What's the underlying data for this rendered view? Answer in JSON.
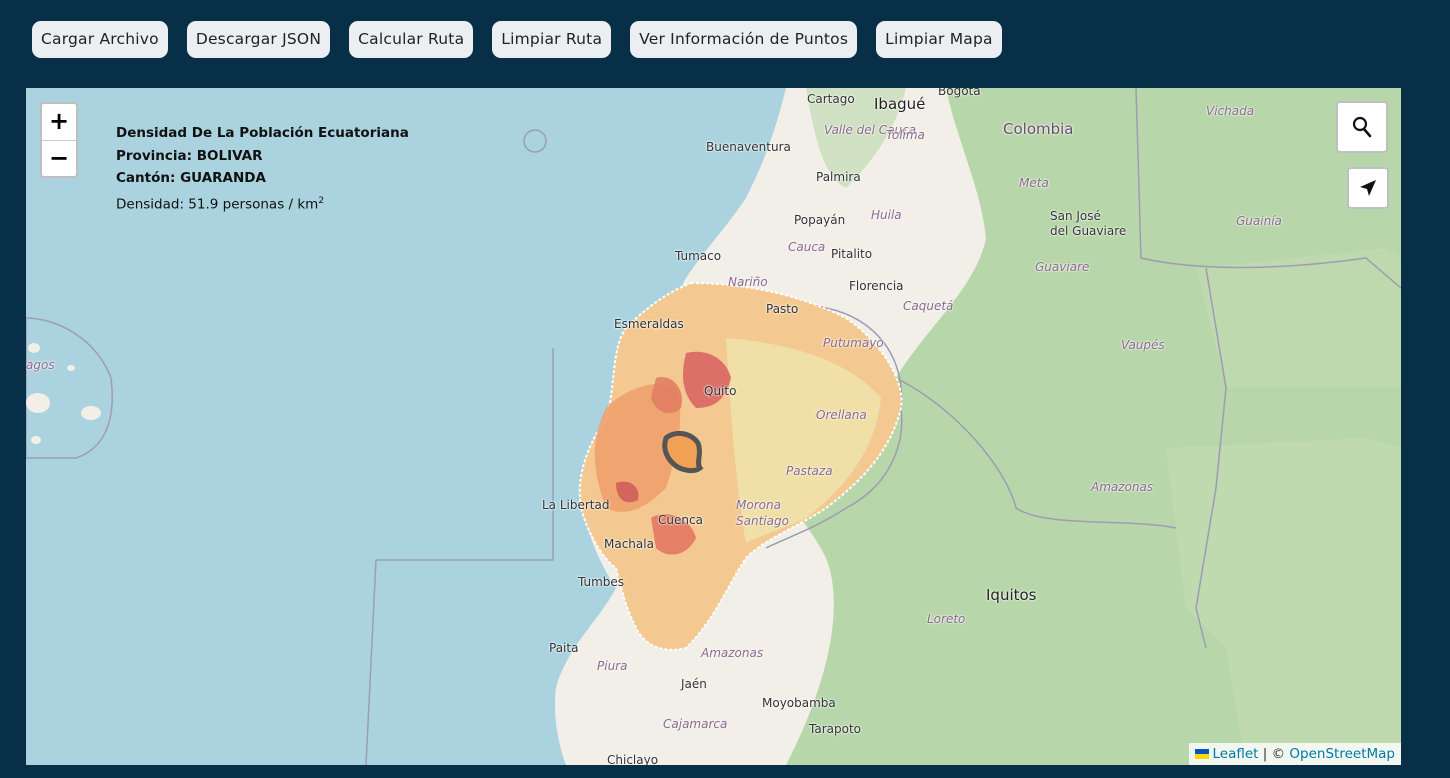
{
  "toolbar": {
    "buttons": [
      "Cargar Archivo",
      "Descargar JSON",
      "Calcular Ruta",
      "Limpiar Ruta",
      "Ver Información de Puntos",
      "Limpiar Mapa"
    ]
  },
  "zoom": {
    "in": "+",
    "out": "−"
  },
  "info": {
    "title": "Densidad De La Población Ecuatoriana",
    "province": "Provincia: BOLIVAR",
    "canton": "Cantón: GUARANDA",
    "density_prefix": "Densidad: 51.9 personas / km",
    "density_sup": "2"
  },
  "attribution": {
    "leaflet": "Leaflet",
    "sep": " | © ",
    "osm": "OpenStreetMap"
  },
  "map_labels": {
    "cartago": "Cartago",
    "ibague": "Ibagué",
    "bogota": "Bogota",
    "valle_cauca": "Valle del Cauca",
    "tolima": "Tolima",
    "colombia": "Colombia",
    "vichada": "Vichada",
    "buenaventura": "Buenaventura",
    "palmira": "Palmira",
    "meta": "Meta",
    "popayan": "Popayán",
    "huila": "Huila",
    "cauca": "Cauca",
    "sanjose1": "San José",
    "sanjose2": "del Guaviare",
    "guainia": "Guainía",
    "tumaco": "Tumaco",
    "pitalito": "Pitalito",
    "narino": "Nariño",
    "florencia": "Florencia",
    "guaviare": "Guaviare",
    "pasto": "Pasto",
    "caqueta": "Caquetá",
    "esmeraldas": "Esmeraldas",
    "putumayo": "Putumayo",
    "vaupes": "Vaupés",
    "galapagos": "agos",
    "quito": "Quito",
    "orellana": "Orellana",
    "pastaza": "Pastaza",
    "amazonas_n": "Amazonas",
    "la_libertad": "La Libertad",
    "morona": "Morona",
    "santiago": "Santiago",
    "cuenca": "Cuenca",
    "machala": "Machala",
    "tumbes": "Tumbes",
    "iquitos": "Iquitos",
    "loreto": "Loreto",
    "paita": "Paita",
    "piura": "Piura",
    "amazonas_s": "Amazonas",
    "jaen": "Jaén",
    "moyobamba": "Moyobamba",
    "cajamarca": "Cajamarca",
    "tarapoto": "Tarapoto",
    "chiclayo": "Chiclayo"
  },
  "colors": {
    "background": "#082f48",
    "sea": "#aad3df",
    "land": "#f2efe9",
    "forest": "#add19e",
    "highlight": "#555555"
  }
}
